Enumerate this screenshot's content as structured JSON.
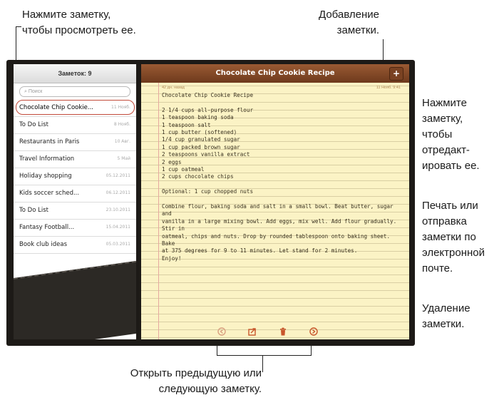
{
  "callouts": {
    "top_left": [
      "Нажмите заметку,",
      "чтобы просмотреть ее."
    ],
    "top_right": [
      "Добавление",
      "заметки."
    ],
    "right_edit": [
      "Нажмите",
      "заметку,",
      "чтобы",
      "отредакт-",
      "ировать ее."
    ],
    "right_share": [
      "Печать или",
      "отправка",
      "заметки по",
      "электронной",
      "почте."
    ],
    "right_delete": [
      "Удаление",
      "заметки."
    ],
    "bottom": [
      "Открыть предыдущую или",
      "следующую заметку."
    ]
  },
  "sidebar": {
    "title": "Заметок: 9",
    "search_placeholder": "Поиск",
    "notes": [
      {
        "title": "Chocolate Chip Cookie...",
        "date": "11 Нояб."
      },
      {
        "title": "To Do List",
        "date": "8 Нояб."
      },
      {
        "title": "Restaurants in Paris",
        "date": "10 Авг."
      },
      {
        "title": "Travel Information",
        "date": "5 Май"
      },
      {
        "title": "Holiday shopping",
        "date": "05.12.2011"
      },
      {
        "title": "Kids soccer sched...",
        "date": "06.12.2011"
      },
      {
        "title": "To Do List",
        "date": "23.10.2011"
      },
      {
        "title": "Fantasy Football...",
        "date": "15.04.2011"
      },
      {
        "title": "Book club ideas",
        "date": "05.03.2011"
      }
    ]
  },
  "note": {
    "title": "Chocolate Chip Cookie Recipe",
    "add_label": "+",
    "date_left": "42 дн. назад",
    "date_right": "11 Нояб.   9:41",
    "lines": [
      "Chocolate Chip Cookie Recipe",
      "",
      "2 1/4 cups all-purpose flour",
      "1 teaspoon baking soda",
      "1 teaspoon salt",
      "1 cup butter (softened)",
      "1/4 cup granulated sugar",
      "1 cup packed brown sugar",
      "2 teaspoons vanilla extract",
      "2 eggs",
      "1 cup oatmeal",
      "2 cups chocolate chips",
      "",
      "Optional: 1 cup chopped nuts",
      "",
      "Combine flour, baking soda and salt in a small bowl. Beat butter, sugar and",
      "vanilla in a large mixing bowl. Add eggs, mix well. Add flour gradually. Stir in",
      "oatmeal, chips and nuts. Drop by rounded tablespoon onto baking sheet. Bake",
      "at 375 degrees for 9 to 11 minutes. Let stand for 2 minutes.",
      "Enjoy!"
    ]
  },
  "toolbar": {
    "prev_icon": "left-arrow-circle-icon",
    "share_icon": "share-icon",
    "trash_icon": "trash-icon",
    "next_icon": "right-arrow-circle-icon"
  },
  "colors": {
    "pad_header": "#7a4222",
    "paper": "#fbf3c5",
    "selection_ring": "#c14a3a",
    "toolbar_icon": "#c8562b"
  }
}
